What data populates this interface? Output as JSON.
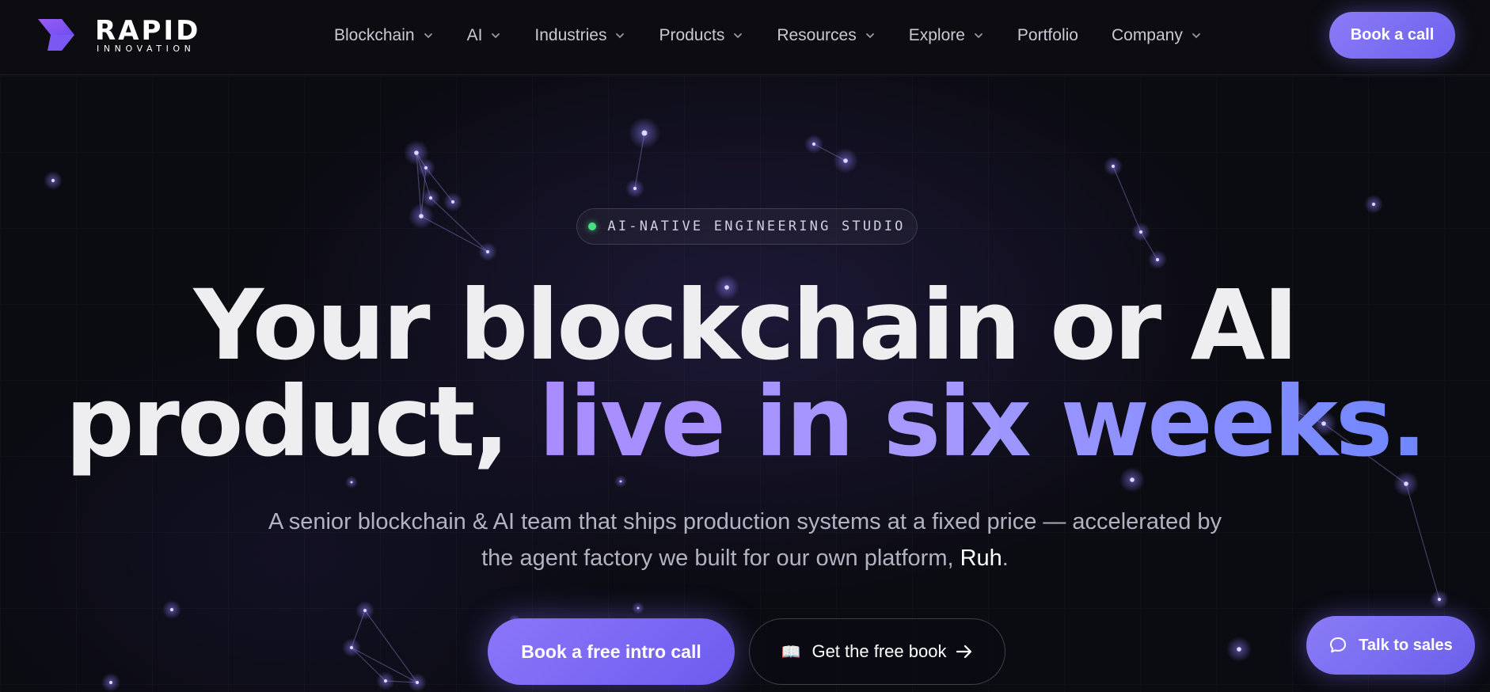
{
  "brand": {
    "name": "RAPID",
    "tagline": "INNOVATION"
  },
  "nav": {
    "items": [
      {
        "label": "Blockchain",
        "has_dropdown": true
      },
      {
        "label": "AI",
        "has_dropdown": true
      },
      {
        "label": "Industries",
        "has_dropdown": true
      },
      {
        "label": "Products",
        "has_dropdown": true
      },
      {
        "label": "Resources",
        "has_dropdown": true
      },
      {
        "label": "Explore",
        "has_dropdown": true
      },
      {
        "label": "Portfolio",
        "has_dropdown": false
      },
      {
        "label": "Company",
        "has_dropdown": true
      }
    ],
    "cta": "Book a call"
  },
  "hero": {
    "badge": "AI-NATIVE ENGINEERING STUDIO",
    "headline_line1": "Your blockchain or AI",
    "headline_line2_plain": "product, ",
    "headline_line2_accent": "live in six weeks.",
    "subtitle_line1": "A senior blockchain & AI team that ships production systems at a fixed price — accelerated by",
    "subtitle_line2_pre": "the agent factory we built for our own platform, ",
    "subtitle_highlight": "Ruh",
    "subtitle_end": ".",
    "primary_cta": "Book a free intro call",
    "secondary_cta": "Get the free book",
    "secondary_icon": "book-icon"
  },
  "chat": {
    "label": "Talk to sales",
    "icon": "chat-bubble-icon"
  },
  "colors": {
    "background": "#0b0b12",
    "accent": "#7c6cf6",
    "accent_gradient_start": "#a98cff",
    "accent_gradient_end": "#6f86ff",
    "status_dot": "#4ade80"
  }
}
